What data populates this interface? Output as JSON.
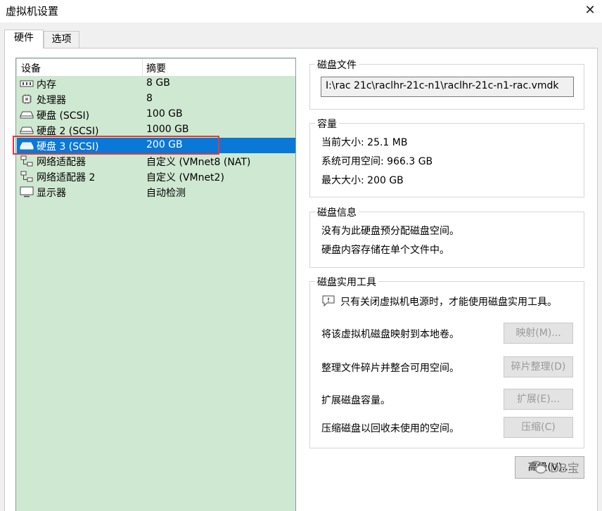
{
  "window": {
    "title": "虚拟机设置"
  },
  "tabs": [
    {
      "label": "硬件"
    },
    {
      "label": "选项"
    }
  ],
  "device_list": {
    "headers": {
      "device": "设备",
      "summary": "摘要"
    },
    "rows": [
      {
        "name": "内存",
        "summary": "8 GB",
        "icon": "memory-icon"
      },
      {
        "name": "处理器",
        "summary": "8",
        "icon": "processor-icon"
      },
      {
        "name": "硬盘 (SCSI)",
        "summary": "100 GB",
        "icon": "harddisk-icon"
      },
      {
        "name": "硬盘 2 (SCSI)",
        "summary": "1000 GB",
        "icon": "harddisk-icon"
      },
      {
        "name": "硬盘 3 (SCSI)",
        "summary": "200 GB",
        "icon": "harddisk-icon",
        "selected": true
      },
      {
        "name": "网络适配器",
        "summary": "自定义 (VMnet8 (NAT)",
        "icon": "network-icon"
      },
      {
        "name": "网络适配器 2",
        "summary": "自定义 (VMnet2)",
        "icon": "network-icon"
      },
      {
        "name": "显示器",
        "summary": "自动检测",
        "icon": "display-icon"
      }
    ]
  },
  "disk_file": {
    "label": "磁盘文件",
    "path": "I:\\rac 21c\\raclhr-21c-n1\\raclhr-21c-n1-rac.vmdk"
  },
  "capacity": {
    "label": "容量",
    "current_size": "当前大小: 25.1 MB",
    "system_free": "系统可用空间: 966.3 GB",
    "max_size": "最大大小: 200 GB"
  },
  "disk_info": {
    "label": "磁盘信息",
    "line1": "没有为此硬盘预分配磁盘空间。",
    "line2": "硬盘内容存储在单个文件中。"
  },
  "disk_utilities": {
    "label": "磁盘实用工具",
    "notice": "只有关闭虚拟机电源时，才能使用磁盘实用工具。",
    "map": {
      "desc": "将该虚拟机磁盘映射到本地卷。",
      "button": "映射(M)..."
    },
    "defrag": {
      "desc": "整理文件碎片并整合可用空间。",
      "button": "碎片整理(D)"
    },
    "expand": {
      "desc": "扩展磁盘容量。",
      "button": "扩展(E)..."
    },
    "compact": {
      "desc": "压缩磁盘以回收未使用的空间。",
      "button": "压缩(C)"
    }
  },
  "advanced_button": "高级(V)...",
  "watermark": "DB宝",
  "colors": {
    "selection": "#0a78d6",
    "list_background": "#cfe8d1",
    "highlight_box": "#e53935"
  }
}
